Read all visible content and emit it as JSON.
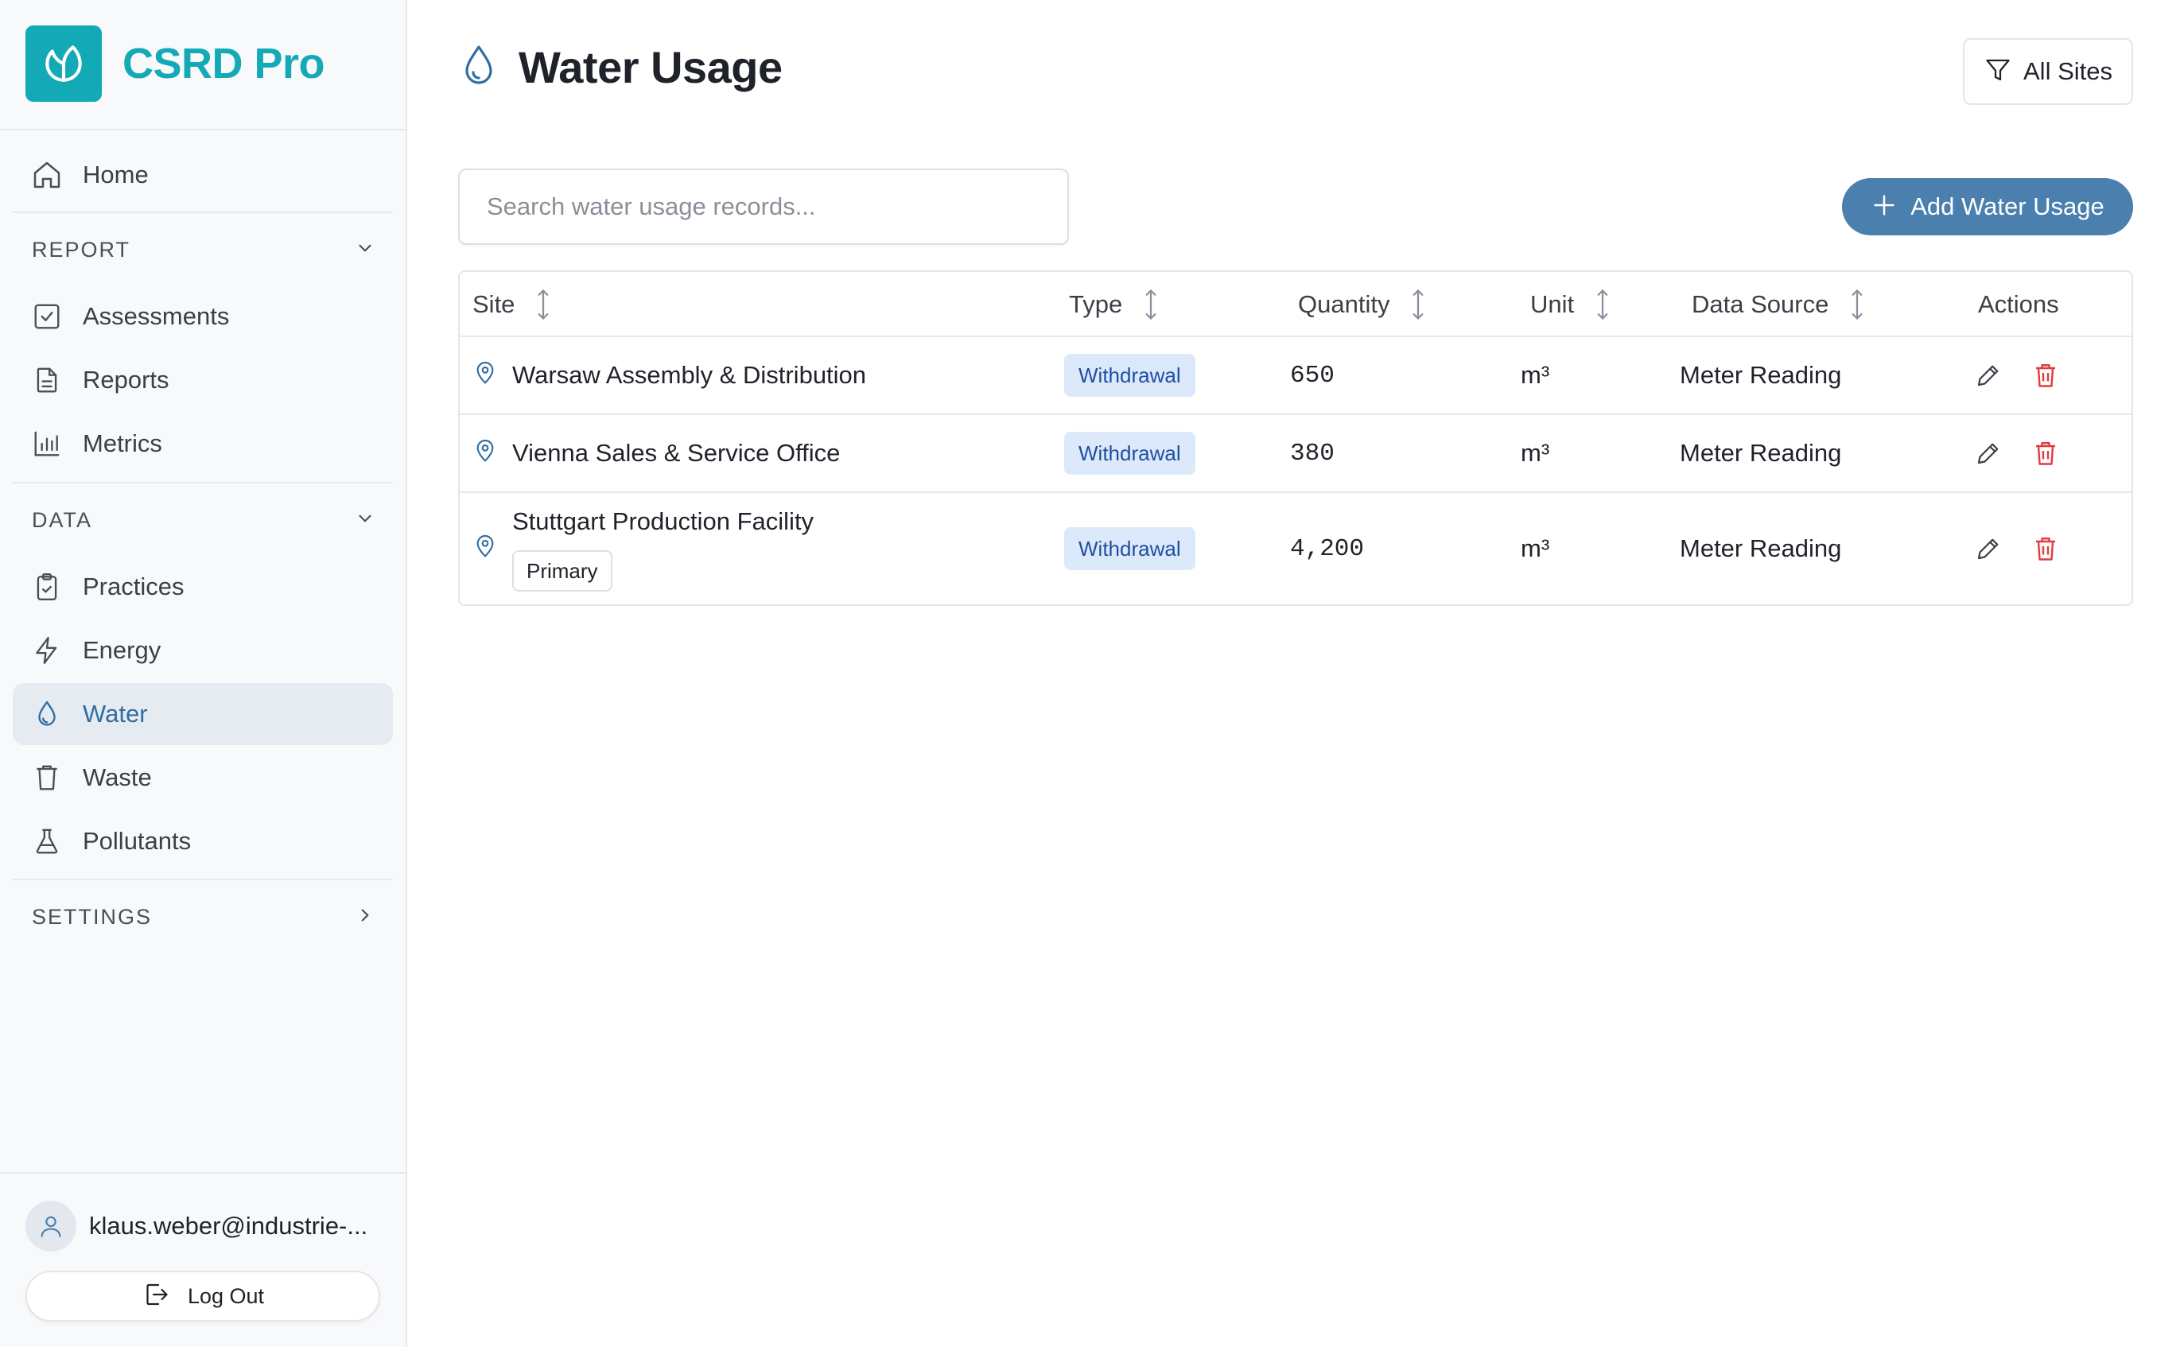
{
  "brand": {
    "name": "CSRD Pro"
  },
  "sidebar": {
    "home": "Home",
    "sections": [
      {
        "label": "REPORT",
        "items": [
          "Assessments",
          "Reports",
          "Metrics"
        ]
      },
      {
        "label": "DATA",
        "items": [
          "Practices",
          "Energy",
          "Water",
          "Waste",
          "Pollutants"
        ]
      },
      {
        "label": "SETTINGS"
      }
    ],
    "active_item": "Water",
    "user_email": "klaus.weber@industrie-...",
    "logout_label": "Log Out"
  },
  "page": {
    "title": "Water Usage",
    "filter_label": "All Sites",
    "search_placeholder": "Search water usage records...",
    "add_label": "Add Water Usage"
  },
  "table": {
    "columns": [
      "Site",
      "Type",
      "Quantity",
      "Unit",
      "Data Source",
      "Actions"
    ],
    "rows": [
      {
        "site": "Warsaw Assembly & Distribution",
        "type": "Withdrawal",
        "quantity": "650",
        "unit": "m³",
        "source": "Meter Reading"
      },
      {
        "site": "Vienna Sales & Service Office",
        "type": "Withdrawal",
        "quantity": "380",
        "unit": "m³",
        "source": "Meter Reading"
      },
      {
        "site": "Stuttgart Production Facility",
        "tag": "Primary",
        "type": "Withdrawal",
        "quantity": "4,200",
        "unit": "m³",
        "source": "Meter Reading"
      }
    ]
  },
  "colors": {
    "brand": "#13a9b6",
    "accent": "#4a7fae",
    "active_text": "#2f6ea3",
    "danger": "#e23b3b",
    "badge_bg": "#dce9fa"
  },
  "icons": [
    "leaf-logo-icon",
    "home-icon",
    "check-square-icon",
    "file-icon",
    "bar-chart-icon",
    "clipboard-check-icon",
    "lightning-icon",
    "droplet-icon",
    "trash-bin-icon",
    "flask-icon",
    "chevron-down-icon",
    "chevron-right-icon",
    "user-icon",
    "logout-icon",
    "filter-icon",
    "plus-icon",
    "sort-icon",
    "map-pin-icon",
    "pencil-icon",
    "delete-icon"
  ]
}
